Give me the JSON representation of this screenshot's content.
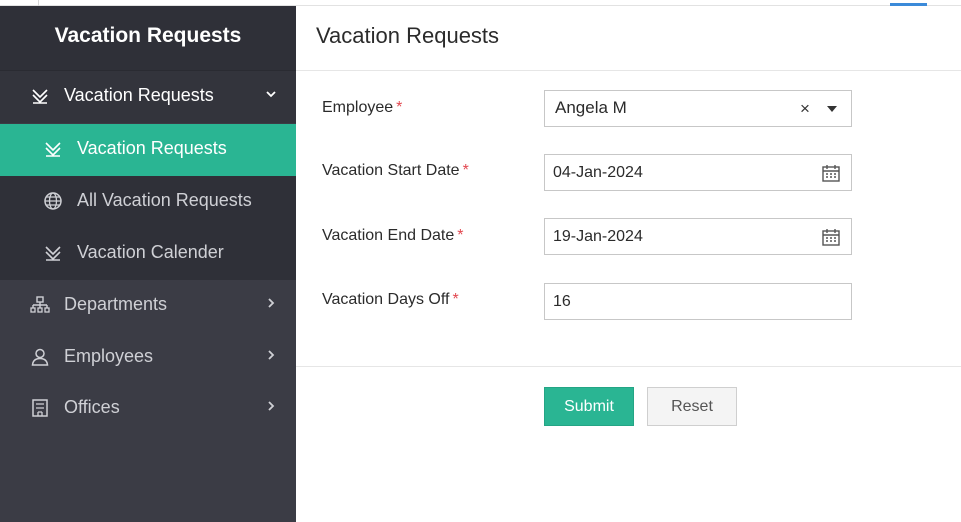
{
  "sidebar": {
    "title": "Vacation Requests",
    "group": {
      "label": "Vacation Requests",
      "icon": "vacation-icon"
    },
    "subitems": [
      {
        "label": "Vacation Requests",
        "icon": "vacation-icon",
        "active": true
      },
      {
        "label": "All Vacation Requests",
        "icon": "globe-icon"
      },
      {
        "label": "Vacation Calender",
        "icon": "vacation-icon"
      }
    ],
    "items": [
      {
        "label": "Departments",
        "icon": "org-chart-icon"
      },
      {
        "label": "Employees",
        "icon": "user-icon"
      },
      {
        "label": "Offices",
        "icon": "building-icon"
      }
    ]
  },
  "main": {
    "title": "Vacation Requests",
    "form": {
      "employee": {
        "label": "Employee",
        "required": "*",
        "value": "Angela M",
        "clear": "×"
      },
      "start_date": {
        "label": "Vacation Start Date",
        "required": "*",
        "value": "04-Jan-2024"
      },
      "end_date": {
        "label": "Vacation End Date",
        "required": "*",
        "value": "19-Jan-2024"
      },
      "days_off": {
        "label": "Vacation Days Off",
        "required": "*",
        "value": "16"
      }
    },
    "buttons": {
      "submit": "Submit",
      "reset": "Reset"
    }
  },
  "colors": {
    "accent": "#2ab593",
    "sidebar_bg": "#3b3c45",
    "required": "#e2474f"
  }
}
